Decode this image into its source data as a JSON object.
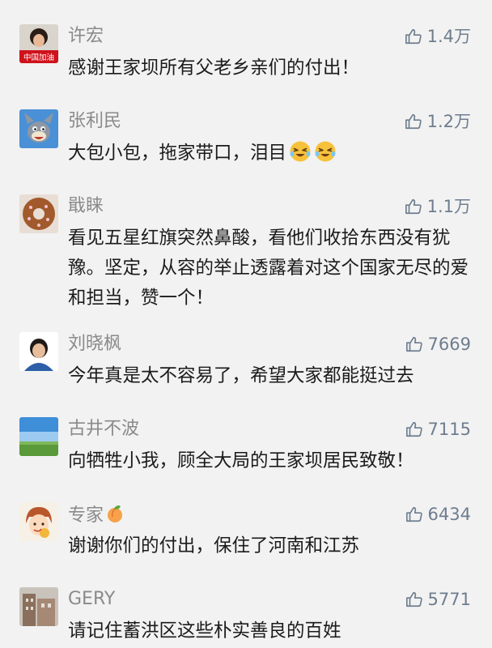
{
  "comments": [
    {
      "name": "许宏",
      "likes": "1.4万",
      "text": "感谢王家坝所有父老乡亲们的付出！",
      "avatar_label": "中国加油"
    },
    {
      "name": "张利民",
      "likes": "1.2万",
      "text": "大包小包，拖家带口，泪目"
    },
    {
      "name": "戢睐",
      "likes": "1.1万",
      "text": "看见五星红旗突然鼻酸，看他们收拾东西没有犹豫。坚定，从容的举止透露着对这个国家无尽的爱和担当，赞一个！"
    },
    {
      "name": "刘晓枫",
      "likes": "7669",
      "text": "今年真是太不容易了，希望大家都能挺过去"
    },
    {
      "name": "古井不波",
      "likes": "7115",
      "text": "向牺牲小我，顾全大局的王家坝居民致敬！"
    },
    {
      "name": "专家",
      "likes": "6434",
      "text": "谢谢你们的付出，保住了河南和江苏"
    },
    {
      "name": "GERY",
      "likes": "5771",
      "text": "请记住蓄洪区这些朴实善良的百姓"
    }
  ],
  "icons": {
    "like": "thumbs-up-icon",
    "emoji": "crying-laughing-emoji",
    "badge": "peach-emoji"
  },
  "colors": {
    "background": "#f2f2f2",
    "username": "#8a8a8a",
    "like_count": "#6e7d8e",
    "text": "#1b1b1b"
  }
}
